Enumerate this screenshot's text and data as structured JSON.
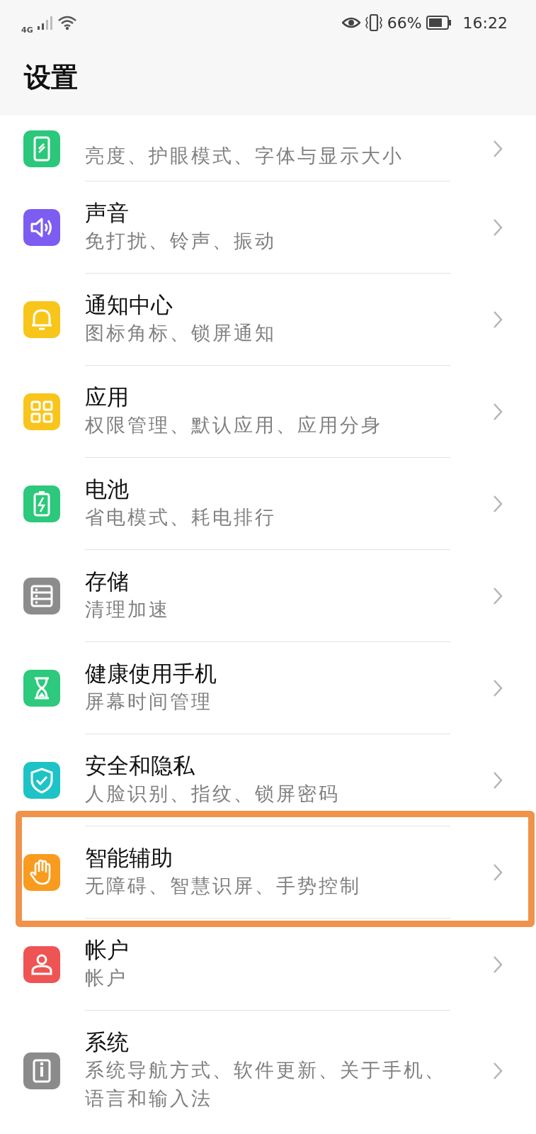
{
  "status_bar": {
    "network": "4G",
    "battery": "66%",
    "time": "16:22"
  },
  "title": "设置",
  "items": [
    {
      "subtitle": "亮度、护眼模式、字体与显示大小",
      "color": "#2bc77a",
      "highlighted": false
    },
    {
      "title": "声音",
      "subtitle": "免打扰、铃声、振动",
      "color": "#7d5cf2",
      "highlighted": false
    },
    {
      "title": "通知中心",
      "subtitle": "图标角标、锁屏通知",
      "color": "#f8c51a",
      "highlighted": false
    },
    {
      "title": "应用",
      "subtitle": "权限管理、默认应用、应用分身",
      "color": "#f9c51c",
      "highlighted": false
    },
    {
      "title": "电池",
      "subtitle": "省电模式、耗电排行",
      "color": "#2cc87b",
      "highlighted": false
    },
    {
      "title": "存储",
      "subtitle": "清理加速",
      "color": "#8c8c8c",
      "highlighted": false
    },
    {
      "title": "健康使用手机",
      "subtitle": "屏幕时间管理",
      "color": "#2dc97c",
      "highlighted": false
    },
    {
      "title": "安全和隐私",
      "subtitle": "人脸识别、指纹、锁屏密码",
      "color": "#1dc3c6",
      "highlighted": false
    },
    {
      "title": "智能辅助",
      "subtitle": "无障碍、智慧识屏、手势控制",
      "color": "#f99b1e",
      "highlighted": true
    },
    {
      "title": "帐户",
      "subtitle": "帐户",
      "color": "#ee5454",
      "highlighted": false
    },
    {
      "title": "系统",
      "subtitle": "系统导航方式、软件更新、关于手机、语言和输入法",
      "color": "#8b8b8b",
      "highlighted": false
    }
  ]
}
